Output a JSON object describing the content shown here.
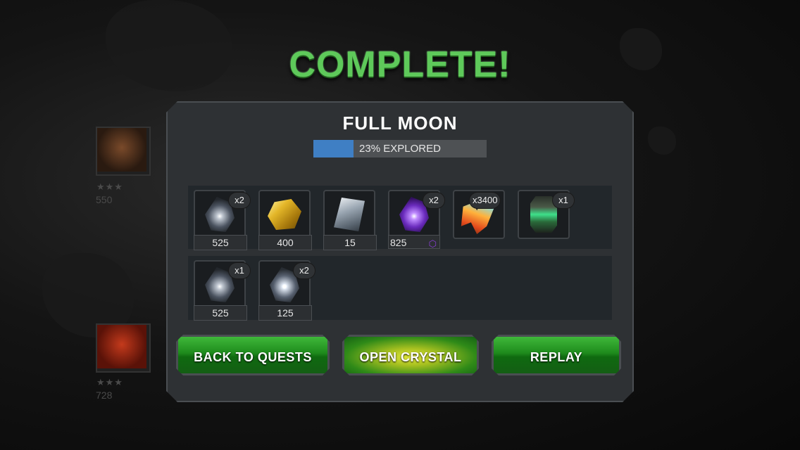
{
  "title": "COMPLETE!",
  "quest": {
    "name": "FULL MOON",
    "explored_percent": 23,
    "explored_label": "23% EXPLORED"
  },
  "background": {
    "champion_1": {
      "stars": "★★★",
      "rating": "550"
    },
    "champion_2": {
      "stars": "★★★",
      "rating": "728"
    }
  },
  "rewards_row1": [
    {
      "icon": "premium-hero-crystal-icon",
      "qty": "x2",
      "value": "525"
    },
    {
      "icon": "gold-icon",
      "qty": "",
      "value": "400"
    },
    {
      "icon": "silver-shard-icon",
      "qty": "",
      "value": "15"
    },
    {
      "icon": "purple-crystal-icon",
      "qty": "x2",
      "value": "825"
    },
    {
      "icon": "crystal-shards-icon",
      "qty": "x3400",
      "value": ""
    },
    {
      "icon": "catalyst-icon",
      "qty": "x1",
      "value": ""
    }
  ],
  "rewards_row2": [
    {
      "icon": "premium-hero-crystal-icon",
      "qty": "x1",
      "value": "525"
    },
    {
      "icon": "hero-crystal-icon",
      "qty": "x2",
      "value": "125"
    }
  ],
  "buttons": {
    "back": "BACK TO QUESTS",
    "open": "OPEN CRYSTAL",
    "replay": "REPLAY"
  }
}
